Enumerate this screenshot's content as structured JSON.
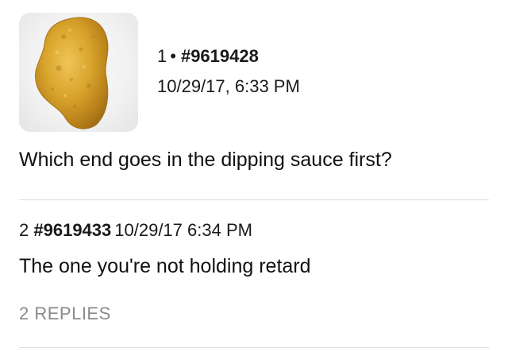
{
  "op": {
    "thumbnail_icon": "chicken-nugget-image",
    "post_number": "1",
    "separator": "•",
    "post_id": "#9619428",
    "date": "10/29/17, 6:33 PM",
    "body": "Which end goes in the dipping sauce first?"
  },
  "reply": {
    "post_number": "2",
    "post_id": "#9619433",
    "date": "10/29/17 6:34 PM",
    "body": "The one you're not holding retard",
    "replies_label": "2 REPLIES"
  },
  "colors": {
    "text": "#111111",
    "muted": "#8a8a8a",
    "divider": "#dcdcdc",
    "nugget": "#d9a52c"
  }
}
